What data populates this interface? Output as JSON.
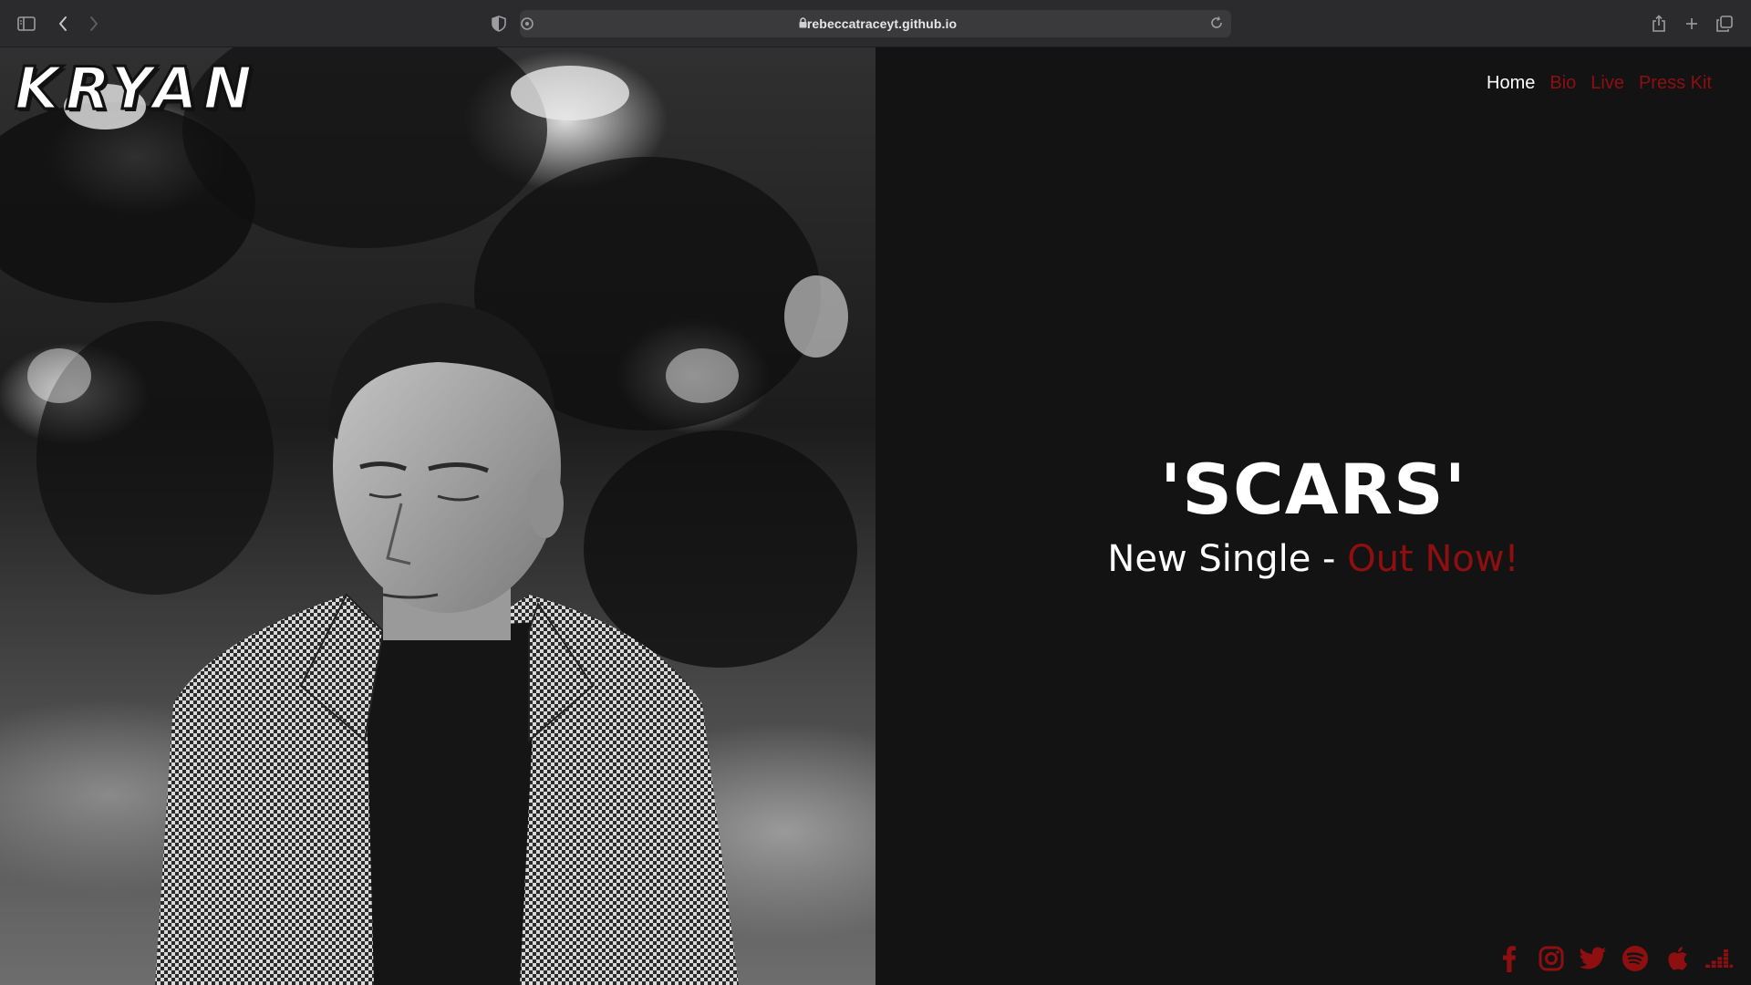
{
  "browser": {
    "url": "rebeccatraceyt.github.io",
    "icons": [
      "sidebar-icon",
      "back-icon",
      "forward-icon",
      "shield-icon",
      "site-settings-icon",
      "lock-icon",
      "reload-icon",
      "share-icon",
      "new-tab-icon",
      "tabs-overview-icon"
    ]
  },
  "site": {
    "logo_text": "KRYAN",
    "nav": [
      {
        "label": "Home",
        "active": true
      },
      {
        "label": "Bio",
        "active": false
      },
      {
        "label": "Live",
        "active": false
      },
      {
        "label": "Press Kit",
        "active": false
      }
    ],
    "hero": {
      "title": "'SCARS'",
      "subtitle_prefix": "New Single - ",
      "subtitle_accent": "Out Now!"
    },
    "social_icons": [
      "facebook-icon",
      "instagram-icon",
      "twitter-icon",
      "spotify-icon",
      "apple-music-icon",
      "deezer-icon"
    ],
    "colors": {
      "background": "#131313",
      "accent": "#8e0f10",
      "text": "#ffffff"
    }
  }
}
